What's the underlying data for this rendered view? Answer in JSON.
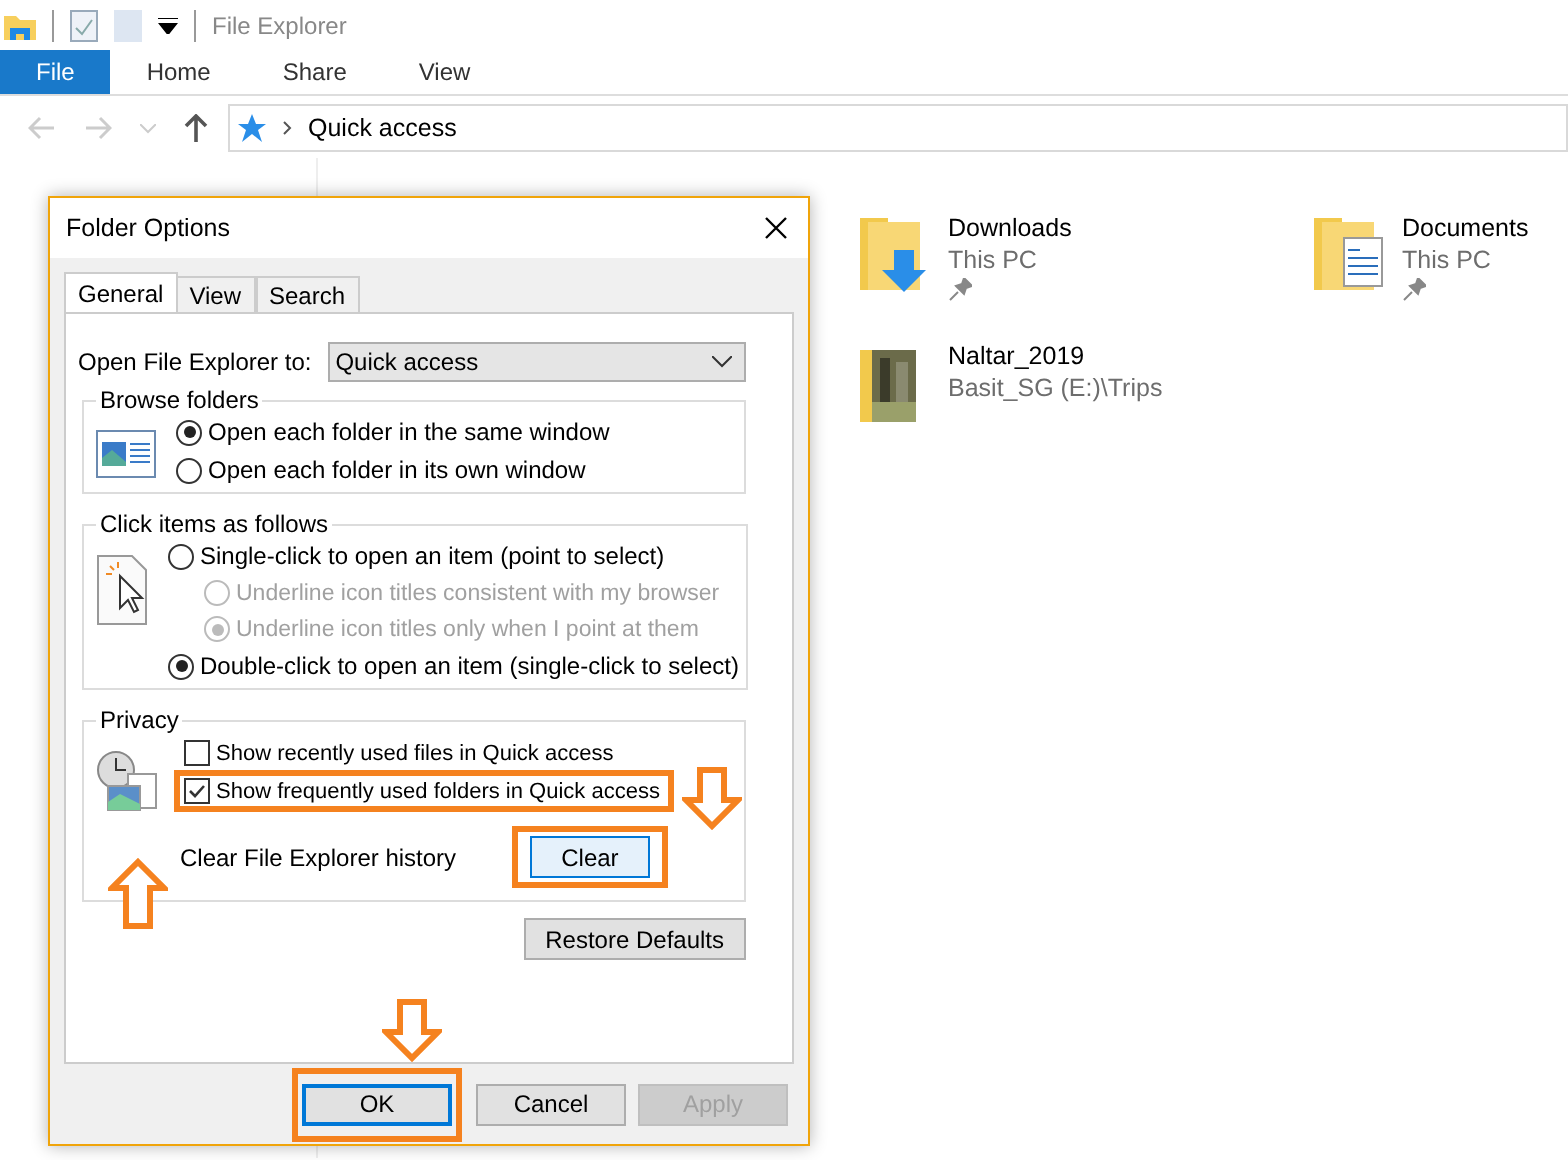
{
  "window": {
    "title": "File Explorer"
  },
  "ribbon_tabs": [
    {
      "label": "File",
      "selected": true
    },
    {
      "label": "Home",
      "selected": false
    },
    {
      "label": "Share",
      "selected": false
    },
    {
      "label": "View",
      "selected": false
    }
  ],
  "address_bar": {
    "path": "Quick access"
  },
  "folders": [
    {
      "name": "Downloads",
      "location": "This PC",
      "pinned": true,
      "kind": "downloads"
    },
    {
      "name": "Documents",
      "location": "This PC",
      "pinned": true,
      "kind": "documents"
    },
    {
      "name": "Naltar_2019",
      "location": "Basit_SG (E:)\\Trips",
      "pinned": false,
      "kind": "picture"
    }
  ],
  "dialog": {
    "title": "Folder Options",
    "tabs": [
      {
        "label": "General",
        "selected": true
      },
      {
        "label": "View",
        "selected": false
      },
      {
        "label": "Search",
        "selected": false
      }
    ],
    "open_to": {
      "label": "Open File Explorer to:",
      "value": "Quick access"
    },
    "browse_folders": {
      "title": "Browse folders",
      "options": [
        {
          "label": "Open each folder in the same window",
          "selected": true,
          "disabled": false,
          "sub": false
        },
        {
          "label": "Open each folder in its own window",
          "selected": false,
          "disabled": false,
          "sub": false
        }
      ]
    },
    "click_items": {
      "title": "Click items as follows",
      "options": [
        {
          "label": "Single-click to open an item (point to select)",
          "selected": false,
          "disabled": false,
          "sub": false
        },
        {
          "label": "Underline icon titles consistent with my browser",
          "selected": false,
          "disabled": true,
          "sub": true
        },
        {
          "label": "Underline icon titles only when I point at them",
          "selected": true,
          "disabled": true,
          "sub": true
        },
        {
          "label": "Double-click to open an item (single-click to select)",
          "selected": true,
          "disabled": false,
          "sub": false
        }
      ]
    },
    "privacy": {
      "title": "Privacy",
      "checkboxes": [
        {
          "label": "Show recently used files in Quick access",
          "checked": false,
          "highlighted": false
        },
        {
          "label": "Show frequently used folders in Quick access",
          "checked": true,
          "highlighted": true
        }
      ],
      "clear_label": "Clear File Explorer history",
      "clear_button": {
        "label": "Clear",
        "highlighted": true
      }
    },
    "restore_button": {
      "label": "Restore Defaults"
    },
    "buttons": [
      {
        "label": "OK",
        "disabled": false,
        "highlighted": true
      },
      {
        "label": "Cancel",
        "disabled": false,
        "highlighted": false
      },
      {
        "label": "Apply",
        "disabled": true,
        "highlighted": false
      }
    ]
  }
}
